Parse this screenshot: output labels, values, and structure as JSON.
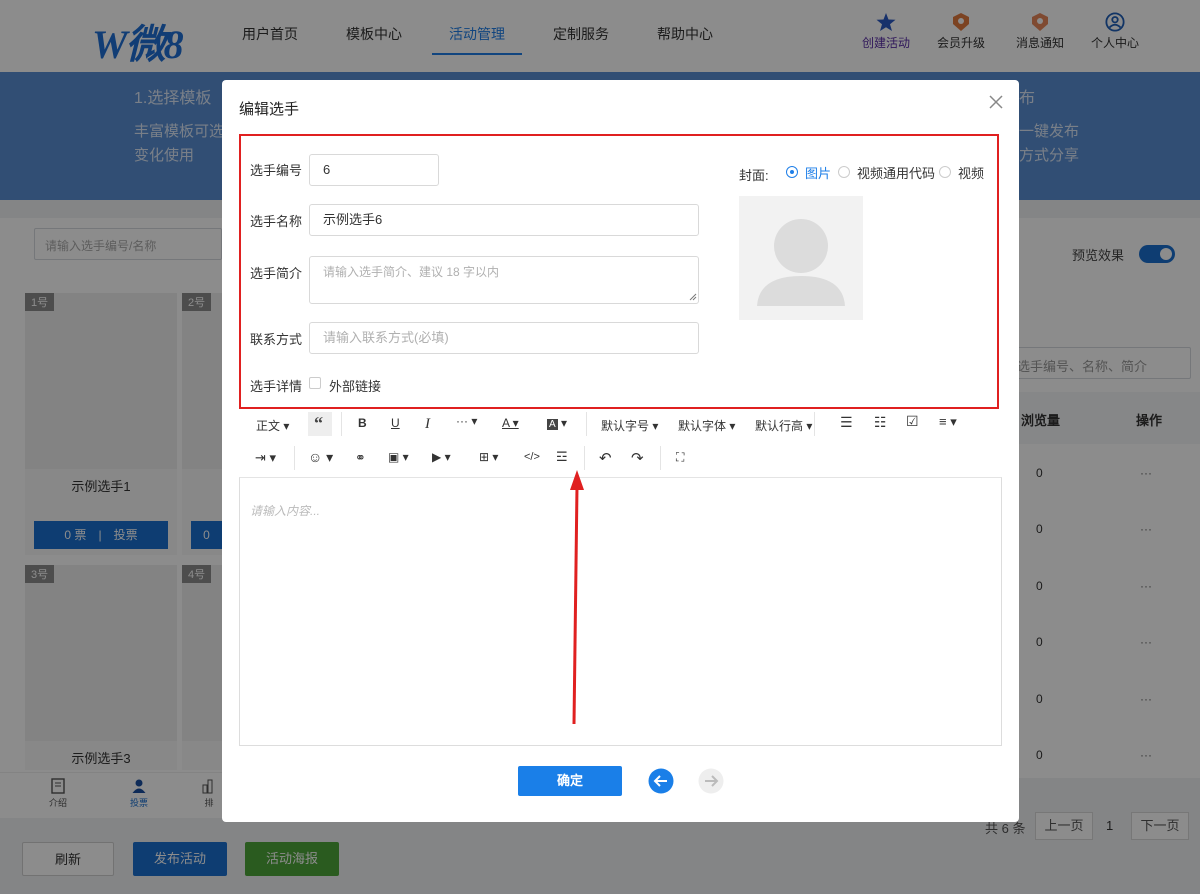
{
  "header": {
    "logo_text": "微8",
    "nav": [
      {
        "label": "用户首页"
      },
      {
        "label": "模板中心"
      },
      {
        "label": "活动管理"
      },
      {
        "label": "定制服务"
      },
      {
        "label": "帮助中心"
      }
    ],
    "actions": [
      {
        "label": "创建活动",
        "icon": "star-icon"
      },
      {
        "label": "会员升级",
        "icon": "badge-icon"
      },
      {
        "label": "消息通知",
        "icon": "bell-icon"
      },
      {
        "label": "个人中心",
        "icon": "user-icon"
      }
    ]
  },
  "banner": {
    "step1_title": "1.选择模板",
    "step1_desc_line1": "丰富模板可选",
    "step1_desc_line2": "变化使用",
    "step_right_title": "布",
    "step_right_desc1": "一键发布",
    "step_right_desc2": "方式分享"
  },
  "left_panel": {
    "search_placeholder": "请输入选手编号/名称",
    "cards": [
      {
        "badge": "1号",
        "name": "示例选手1",
        "votes": "0 票",
        "vote_btn": "投票"
      },
      {
        "badge": "2号",
        "name": "",
        "votes": "0",
        "vote_btn": ""
      },
      {
        "badge": "3号",
        "name": "示例选手3"
      },
      {
        "badge": "4号"
      }
    ],
    "tabs": [
      {
        "label": "介绍"
      },
      {
        "label": "投票"
      },
      {
        "label": "排"
      }
    ]
  },
  "right_panel": {
    "preview_label": "预览效果",
    "search_placeholder": "选手编号、名称、简介",
    "col_views": "浏览量",
    "col_ops": "操作",
    "rows": [
      {
        "views": "0",
        "ops": "···"
      },
      {
        "views": "0",
        "ops": "···"
      },
      {
        "views": "0",
        "ops": "···"
      },
      {
        "views": "0",
        "ops": "···"
      },
      {
        "views": "0",
        "ops": "···"
      },
      {
        "views": "0",
        "ops": "···"
      }
    ],
    "pagination": {
      "total": "共 6 条",
      "prev": "上一页",
      "page": "1",
      "next": "下一页"
    }
  },
  "bottom_buttons": {
    "refresh": "刷新",
    "publish": "发布活动",
    "poster": "活动海报"
  },
  "modal": {
    "title": "编辑选手",
    "close_icon": "close-icon",
    "fields": {
      "number_label": "选手编号",
      "number_value": "6",
      "name_label": "选手名称",
      "name_value": "示例选手6",
      "intro_label": "选手简介",
      "intro_placeholder": "请输入选手简介、建议 18 字以内",
      "contact_label": "联系方式",
      "contact_placeholder": "请输入联系方式(必填)",
      "detail_label": "选手详情",
      "external_link_label": "外部链接"
    },
    "cover": {
      "label": "封面:",
      "options": [
        {
          "label": "图片",
          "selected": true
        },
        {
          "label": "视频通用代码",
          "selected": false
        },
        {
          "label": "视频",
          "selected": false
        }
      ]
    },
    "toolbar": {
      "row1": [
        "正文",
        "默认字号",
        "默认字体",
        "默认行高"
      ],
      "icons": [
        "quote-icon",
        "bold-icon",
        "underline-icon",
        "italic-icon",
        "more-icon",
        "font-color-icon",
        "bg-color-icon",
        "bullet-list-icon",
        "numbered-list-icon",
        "todo-icon",
        "align-icon",
        "indent-icon",
        "emoji-icon",
        "link-icon",
        "image-icon",
        "video-icon",
        "table-icon",
        "code-icon",
        "divider-icon",
        "undo-icon",
        "redo-icon",
        "fullscreen-icon"
      ]
    },
    "editor_placeholder": "请输入内容...",
    "confirm": "确定",
    "colors": {
      "accent": "#1f7fe8",
      "highlight": "#e02020",
      "primary_btn": "#1a7fe8"
    }
  }
}
